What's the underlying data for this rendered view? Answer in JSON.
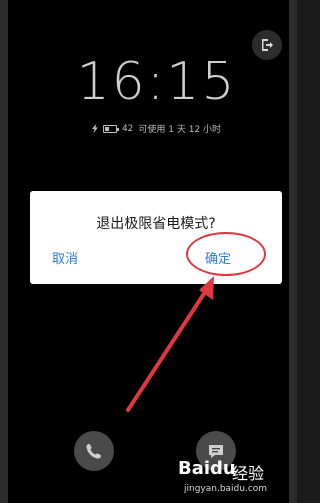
{
  "lock_screen": {
    "time": "16:15",
    "battery_percent": "42",
    "battery_level": 0.42,
    "usage_text": "可使用 1 天 12 小时"
  },
  "dialog": {
    "title": "退出极限省电模式?",
    "cancel_label": "取消",
    "confirm_label": "确定"
  },
  "annotation": {
    "color": "#e0383e"
  },
  "watermark": {
    "brand": "Baidu",
    "cn": "经验",
    "url": "jingyan.baidu.com"
  },
  "icons": {
    "exit": "exit-icon",
    "phone": "phone-icon",
    "message": "message-icon",
    "charging": "lightning-icon",
    "battery": "battery-icon"
  }
}
